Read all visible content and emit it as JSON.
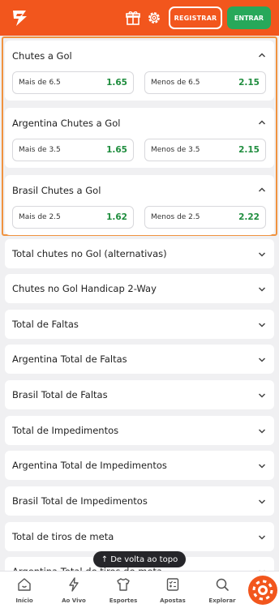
{
  "header": {
    "register_label": "REGISTRAR",
    "login_label": "ENTRAR",
    "brand_color": "#f2561d"
  },
  "open_markets": [
    {
      "title": "Chutes a Gol",
      "over_label": "Mais de 6.5",
      "over_odd": "1.65",
      "under_label": "Menos de 6.5",
      "under_odd": "2.15"
    },
    {
      "title": "Argentina Chutes a Gol",
      "over_label": "Mais de 3.5",
      "over_odd": "1.65",
      "under_label": "Menos de 3.5",
      "under_odd": "2.15"
    },
    {
      "title": "Brasil Chutes a Gol",
      "over_label": "Mais de 2.5",
      "over_odd": "1.62",
      "under_label": "Menos de 2.5",
      "under_odd": "2.22"
    }
  ],
  "collapsed_markets": [
    "Total chutes no Gol (alternativas)",
    "Chutes no Gol Handicap 2-Way",
    "Total de Faltas",
    "Argentina Total de Faltas",
    "Brasil Total de Faltas",
    "Total de Impedimentos",
    "Argentina Total de Impedimentos",
    "Brasil Total de Impedimentos",
    "Total de tiros de meta",
    "Argentina Total de tiros de meta"
  ],
  "back_to_top": {
    "arrow": "↑",
    "label": "De volta ao topo"
  },
  "bottom_nav": [
    {
      "label": "Início",
      "icon": "home-icon"
    },
    {
      "label": "Ao Vivo",
      "icon": "lightning-icon"
    },
    {
      "label": "Esportes",
      "icon": "shirt-icon"
    },
    {
      "label": "Apostas",
      "icon": "betslip-icon"
    },
    {
      "label": "Explorar",
      "icon": "search-icon"
    }
  ],
  "odds_color": "#1f8d3e"
}
